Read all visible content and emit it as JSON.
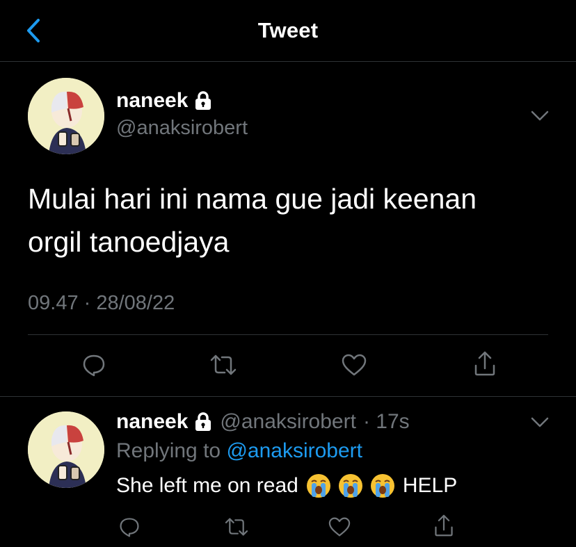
{
  "header": {
    "title": "Tweet",
    "back_icon": "chevron-left-icon"
  },
  "tweet": {
    "display_name": "naneek",
    "handle": "@anaksirobert",
    "text_line1": "Mulai hari ini nama gue jadi keenan",
    "text_line2": "orgil tanoedjaya",
    "timestamp": "09.47 · 28/08/22",
    "actions": [
      "comment-icon",
      "retweet-icon",
      "like-icon",
      "share-icon"
    ]
  },
  "reply": {
    "display_name": "naneek",
    "handle": "@anaksirobert",
    "time": "· 17s",
    "replying_prefix": "Replying to",
    "replying_to": "@anaksirobert",
    "text": "She left me on read",
    "suffix": "HELP",
    "emoji_name": "loudly-crying-face"
  },
  "colors": {
    "background": "#000000",
    "accent": "#1d9bf0",
    "muted": "#71767b",
    "divider": "#2f3336"
  }
}
